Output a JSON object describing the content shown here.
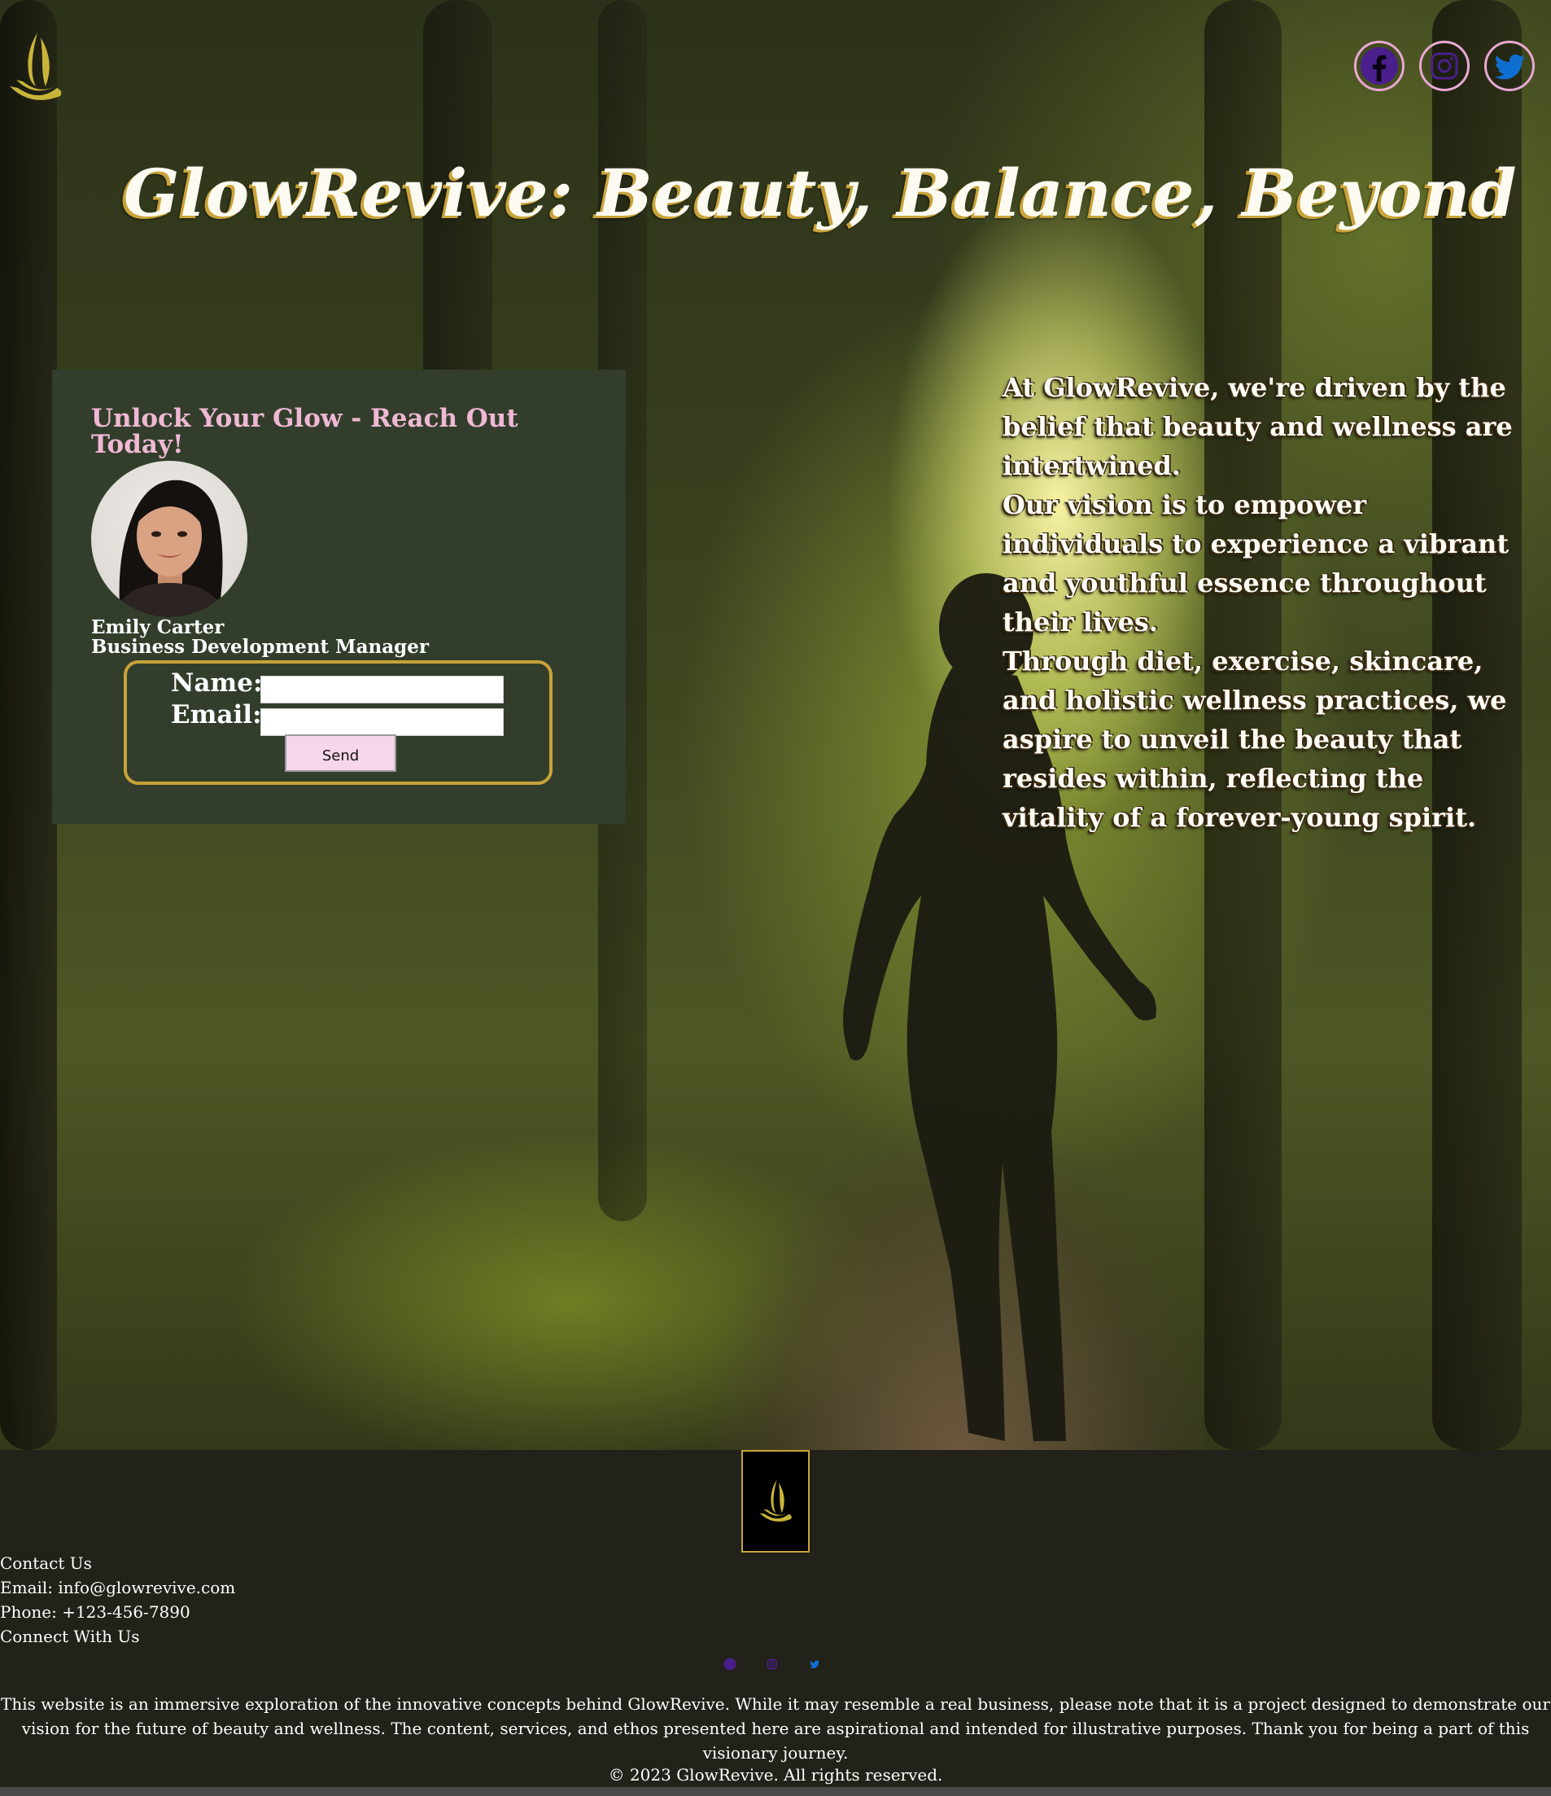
{
  "brand": {
    "name": "GlowRevive",
    "accent": "#c8a33a",
    "pink": "#f0b8d4",
    "panel": "#323e2b"
  },
  "hero": {
    "title": "GlowRevive: Beauty, Balance, Beyond"
  },
  "social": [
    {
      "icon": "facebook-icon",
      "color": "#4a1f8c"
    },
    {
      "icon": "instagram-icon",
      "color": "#4a1f8c"
    },
    {
      "icon": "twitter-icon",
      "color": "#0f6fd1"
    }
  ],
  "contact": {
    "heading": "Unlock Your Glow - Reach Out Today!",
    "person_name": "Emily Carter",
    "person_role": "Business Development Manager",
    "name_label": "Name:",
    "email_label": "Email:",
    "name_value": "",
    "email_value": "",
    "send_label": "Send"
  },
  "mission": {
    "p1": "At GlowRevive, we're driven by the belief that beauty and wellness are intertwined.",
    "p2": "Our vision is to empower individuals to experience a vibrant and youthful essence throughout their lives.",
    "p3": "Through diet, exercise, skincare, and holistic wellness practices, we aspire to unveil the beauty that resides within, reflecting the vitality of a forever-young spirit."
  },
  "footer": {
    "contact_heading": "Contact Us",
    "email": "Email: info@glowrevive.com",
    "phone": "Phone: +123-456-7890",
    "connect_heading": "Connect With Us",
    "disclaimer": "This website is an immersive exploration of the innovative concepts behind GlowRevive. While it may resemble a real business, please note that it is a project designed to demonstrate our vision for the future of beauty and wellness. The content, services, and ethos presented here are aspirational and intended for illustrative purposes. Thank you for being a part of this visionary journey.",
    "copyright": "© 2023 GlowRevive. All rights reserved."
  }
}
